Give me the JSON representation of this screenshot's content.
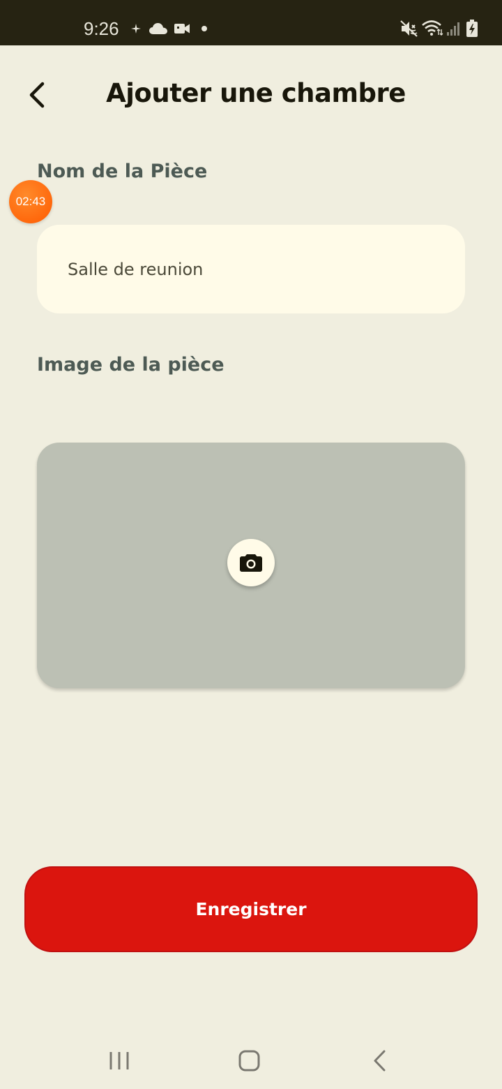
{
  "status_bar": {
    "time": "9:26",
    "icons": [
      "sparkle-icon",
      "cloud-icon",
      "video-icon",
      "dot-icon",
      "mute-icon",
      "wifi-icon",
      "signal-icon",
      "battery-charging-icon"
    ]
  },
  "header": {
    "back_icon": "chevron-left-icon",
    "title": "Ajouter une chambre"
  },
  "timer_badge": {
    "text": "02:43",
    "color": "#ff6a10"
  },
  "form": {
    "name_label": "Nom de la Pièce",
    "name_value": "Salle de reunion",
    "image_label": "Image de la pièce",
    "camera_icon": "camera-icon"
  },
  "save_button": {
    "label": "Enregistrer",
    "color": "#db150e"
  },
  "nav_bar": {
    "icons": [
      "recent-apps-icon",
      "home-icon",
      "back-icon"
    ]
  }
}
